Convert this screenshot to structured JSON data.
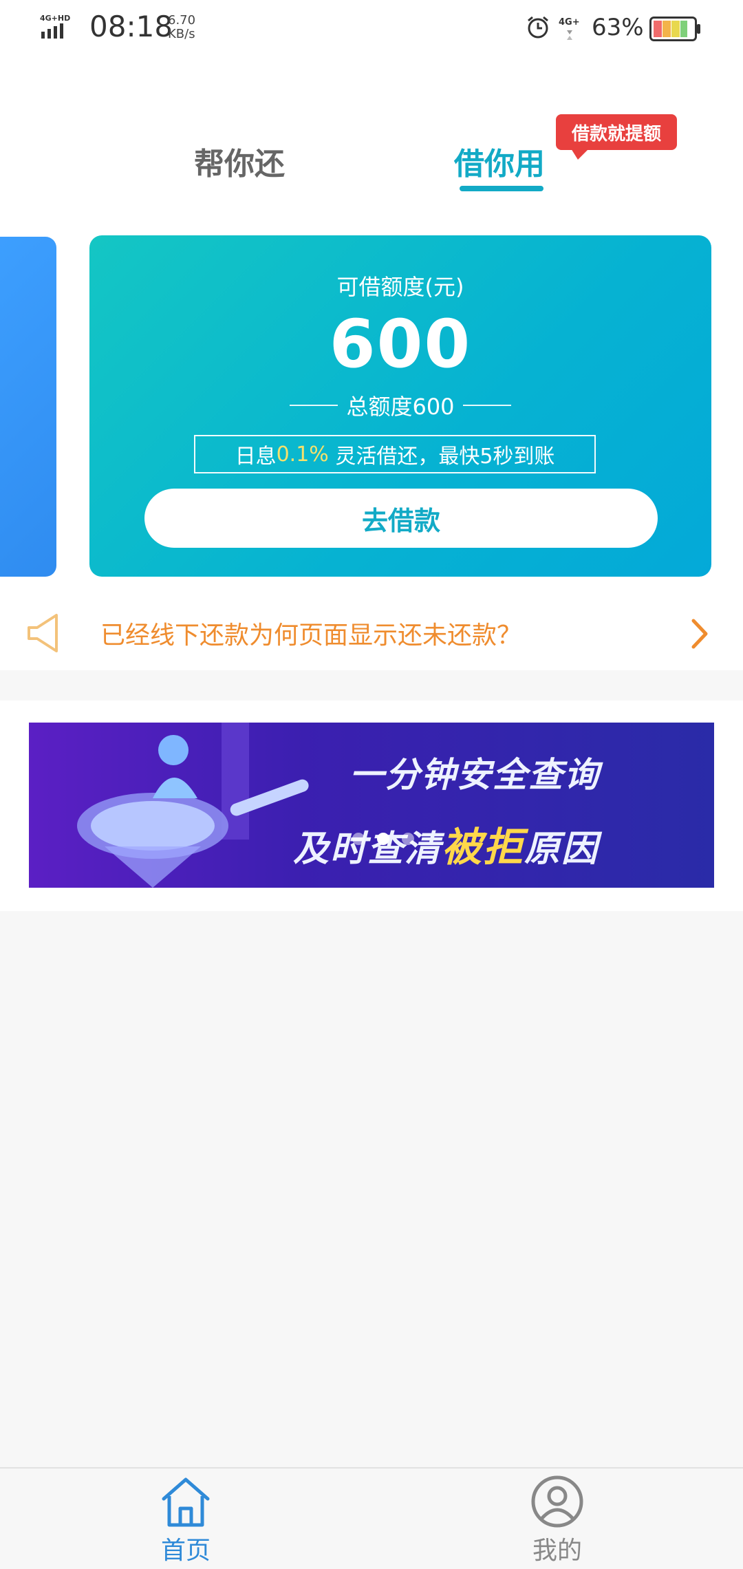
{
  "status_bar": {
    "network_label": "4G+HD",
    "time": "08:18",
    "speed_value": "6.70",
    "speed_unit": "KB/s",
    "net2_label": "4G+",
    "battery_percent": "63%"
  },
  "header": {
    "tab_repay": "帮你还",
    "tab_borrow": "借你用",
    "active_tab": "借你用",
    "promo_badge": "借款就提额"
  },
  "loan_card": {
    "label": "可借额度(元)",
    "amount": "600",
    "total_label": "总额度600",
    "info_prefix": "日息",
    "info_rate": "0.1%",
    "info_suffix": " 灵活借还，最快5秒到账",
    "button_label": "去借款"
  },
  "notice": {
    "text": "已经线下还款为何页面显示还未还款？"
  },
  "banner": {
    "line1": "一分钟安全查询",
    "line2_a": "及时查清",
    "line2_b": "被拒",
    "line2_c": "原因",
    "active_slide": 2,
    "slide_count": 3
  },
  "bottom_nav": {
    "home_label": "首页",
    "mine_label": "我的",
    "active": "首页"
  },
  "colors": {
    "accent": "#12aac6",
    "notice": "#ef8c2e",
    "badge": "#e8403e",
    "nav_active": "#2f8ad8"
  },
  "icons": [
    "signal-icon",
    "alarm-icon",
    "battery-icon",
    "speaker-icon",
    "chevron-right-icon",
    "home-icon",
    "user-icon"
  ]
}
